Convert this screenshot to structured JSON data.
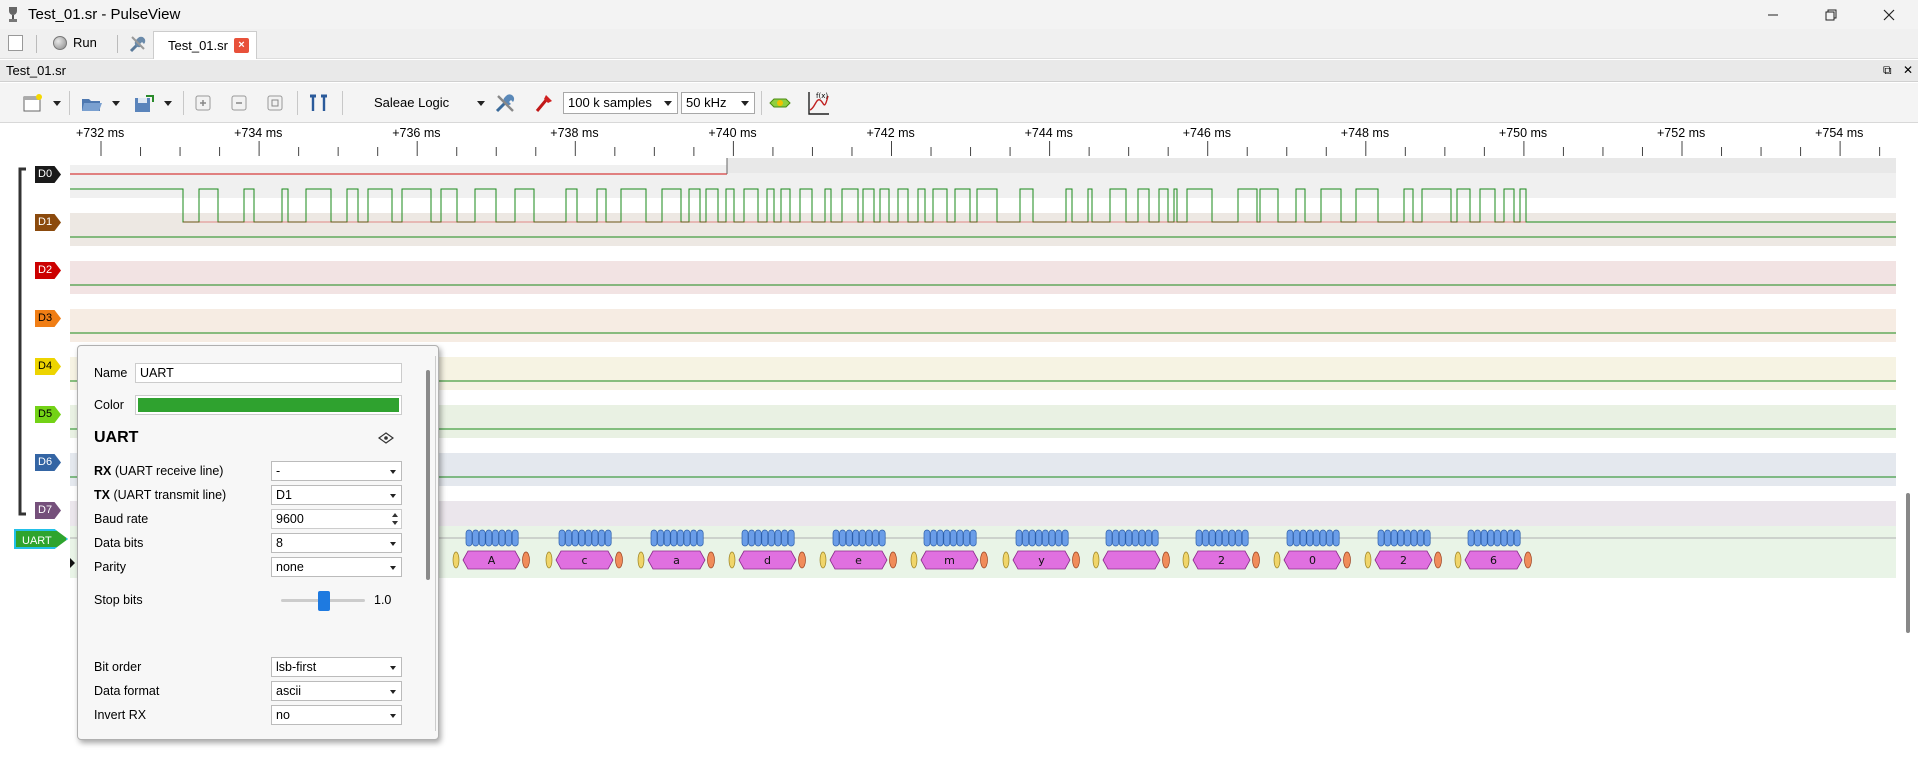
{
  "window": {
    "title": "Test_01.sr - PulseView"
  },
  "tabbar": {
    "run_label": "Run",
    "tab_label": "Test_01.sr",
    "tab_close": "×"
  },
  "document": {
    "name": "Test_01.sr"
  },
  "toolbar": {
    "device": "Saleae Logic",
    "samples": "100 k samples",
    "rate": "50 kHz"
  },
  "ruler": {
    "labels": [
      "+732 ms",
      "+734 ms",
      "+736 ms",
      "+738 ms",
      "+740 ms",
      "+742 ms",
      "+744 ms",
      "+746 ms",
      "+748 ms",
      "+750 ms",
      "+752 ms",
      "+754 ms"
    ]
  },
  "channels": [
    {
      "name": "D0",
      "color": "#1a1a1a",
      "text": "#ffffff",
      "bg": "#f0f0f0"
    },
    {
      "name": "D1",
      "color": "#8b4a0d",
      "text": "#ffffff",
      "bg": "#ede8e3"
    },
    {
      "name": "D2",
      "color": "#cc0000",
      "text": "#ffffff",
      "bg": "#f2e3e3"
    },
    {
      "name": "D3",
      "color": "#f07e15",
      "text": "#000000",
      "bg": "#f6ece3"
    },
    {
      "name": "D4",
      "color": "#edd400",
      "text": "#000000",
      "bg": "#f6f3e3"
    },
    {
      "name": "D5",
      "color": "#73d216",
      "text": "#000000",
      "bg": "#e9f1e3"
    },
    {
      "name": "D6",
      "color": "#3465a4",
      "text": "#ffffff",
      "bg": "#e4e8ee"
    },
    {
      "name": "D7",
      "color": "#75507b",
      "text": "#ffffff",
      "bg": "#ebe6ec"
    }
  ],
  "decoder": {
    "label": "UART",
    "color": "#2ea42e",
    "chars": [
      "",
      "A",
      "c",
      "a",
      "d",
      "e",
      "m",
      "y",
      "",
      "2",
      "0",
      "2",
      "6"
    ]
  },
  "popup": {
    "name_label": "Name",
    "name_value": "UART",
    "color_label": "Color",
    "color_value": "#2fa22f",
    "heading": "UART",
    "rx_bold": "RX",
    "rx_rest": " (UART receive line)",
    "rx_value": "-",
    "tx_bold": "TX",
    "tx_rest": " (UART transmit line)",
    "tx_value": "D1",
    "baud_label": "Baud rate",
    "baud_value": "9600",
    "databits_label": "Data bits",
    "databits_value": "8",
    "parity_label": "Parity",
    "parity_value": "none",
    "stopbits_label": "Stop bits",
    "stopbits_value": "1.0",
    "bitorder_label": "Bit order",
    "bitorder_value": "lsb-first",
    "format_label": "Data format",
    "format_value": "ascii",
    "invert_label": "Invert RX",
    "invert_value": "no"
  }
}
